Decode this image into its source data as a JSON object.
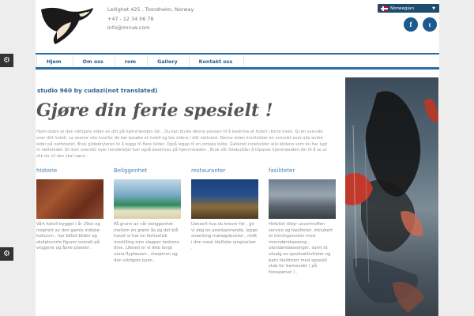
{
  "header": {
    "address": "Leilighet 425 , Trondheim, Norway",
    "phone": "+47 - 12 34 56 78",
    "email": "info@imruw.com"
  },
  "language": {
    "selected": "Norwegian"
  },
  "social": {
    "facebook_icon": "f",
    "twitter_icon": "t"
  },
  "nav": {
    "items": [
      {
        "label": "Hjem"
      },
      {
        "label": "Om oss"
      },
      {
        "label": "rom"
      },
      {
        "label": "Gallery"
      },
      {
        "label": "Kontakt oss"
      }
    ]
  },
  "main": {
    "subtitle": "studio 960 by cudazi(not translated)",
    "headline": "Gjøre din ferie spesielt !",
    "intro": "Hjem-siden er den viktigste siden av ditt på hjemmesiden din . Du kan bruke denne plassen til å beskrive et hotell i korte trekk. Gi en oversikt over ditt hotell. La veerne vite hvorfor de bør besøke et hotell og bla videre i ditt nettsted. Denne siden inneholder en oversikt over alle andre sider på nettstedet. Bruk glidebryteren til å legge til flere bilder. Også legge til en omtale bilde. Galleriet inneholder alle bildene som du har lagt til nettstedet. En kort oversikt over romdetaljer kan også beskrives på hjemmesiden . Bruk vår Sitebuilder å tilpasse hjemmesiden din til å se ut slik du vil den skal være .",
    "columns": [
      {
        "title": "historie",
        "text": "Vårt hotell bygget i år 19xx og inspirert av den gamle indiske kulturen , har billed bilder og skulpturerte figurer overalt på veggene og åpne plasser ."
      },
      {
        "title": "Beliggenhet",
        "text": "På grunn av vår beliggenhet mellom en grønn ås og det blå havet vi har en fantastisk innstilling som slapper tankene dine. Likevel er vi ikke langt unna flyplassen , stasjonen og den viktigste byen ."
      },
      {
        "title": "restauranter",
        "text": "Uansett hva du krever for , gir vi deg en anerkjennende, leppe smacking matopplevelse , midt i den mest idylliske omgivelser ."
      },
      {
        "title": "fasiliteter",
        "text": "Hotellet tilbyr uovertruffen service og fasiliteter, inkludert et treningssenter med innendørsbasseng , utendørsbassenger, samt et utvalg av sportsaktiviteter og barn fasiliteter med spesiell stab for barnevakt ( på forespørsel ) ."
      }
    ]
  },
  "colors": {
    "accent": "#2b6da1",
    "link": "#2b5f8e",
    "social": "#1a5a8f"
  }
}
